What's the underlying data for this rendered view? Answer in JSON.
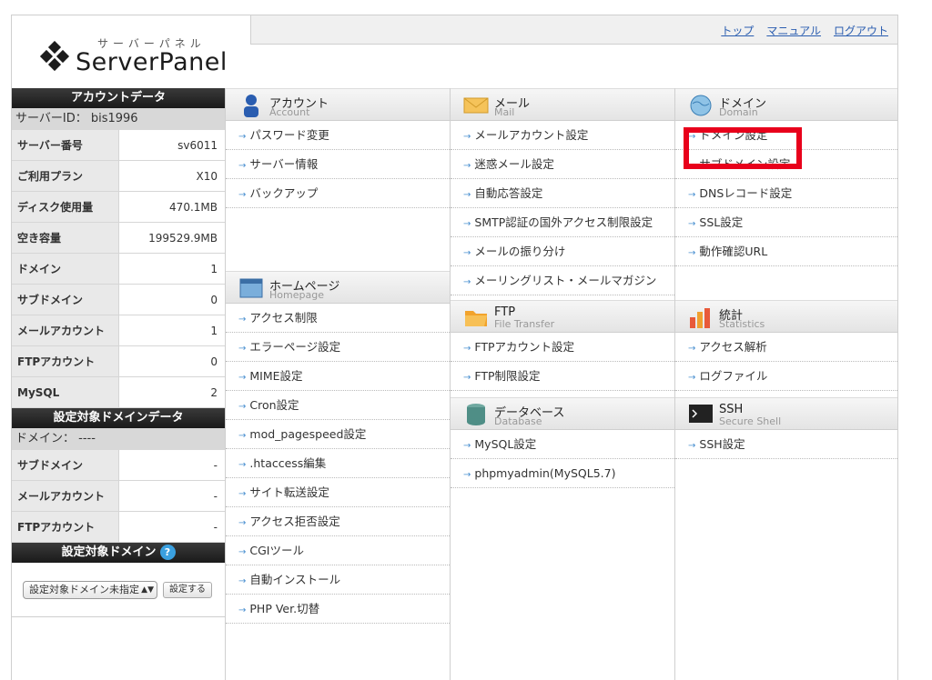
{
  "logo": {
    "kana": "サーバーパネル",
    "name": "ServerPanel"
  },
  "toplinks": [
    "トップ",
    "マニュアル",
    "ログアウト"
  ],
  "account_data": {
    "heading": "アカウントデータ",
    "server_id_label": "サーバーID：",
    "server_id": "bis1996",
    "rows": [
      {
        "label": "サーバー番号",
        "value": "sv6011"
      },
      {
        "label": "ご利用プラン",
        "value": "X10"
      },
      {
        "label": "ディスク使用量",
        "value": "470.1MB"
      },
      {
        "label": "空き容量",
        "value": "199529.9MB"
      },
      {
        "label": "ドメイン",
        "value": "1"
      },
      {
        "label": "サブドメイン",
        "value": "0"
      },
      {
        "label": "メールアカウント",
        "value": "1"
      },
      {
        "label": "FTPアカウント",
        "value": "0"
      },
      {
        "label": "MySQL",
        "value": "2"
      }
    ]
  },
  "domain_data": {
    "heading": "設定対象ドメインデータ",
    "domain_label": "ドメイン：",
    "domain_value": "----",
    "rows": [
      {
        "label": "サブドメイン",
        "value": "-"
      },
      {
        "label": "メールアカウント",
        "value": "-"
      },
      {
        "label": "FTPアカウント",
        "value": "-"
      }
    ]
  },
  "target_domain": {
    "heading": "設定対象ドメイン",
    "help": "?",
    "select_value": "設定対象ドメイン未指定",
    "button": "設定する"
  },
  "sections": {
    "account": {
      "title": "アカウント",
      "sub": "Account",
      "items": [
        "パスワード変更",
        "サーバー情報",
        "バックアップ"
      ]
    },
    "mail": {
      "title": "メール",
      "sub": "Mail",
      "items": [
        "メールアカウント設定",
        "迷惑メール設定",
        "自動応答設定",
        "SMTP認証の国外アクセス制限設定",
        "メールの振り分け",
        "メーリングリスト・メールマガジン"
      ]
    },
    "domain": {
      "title": "ドメイン",
      "sub": "Domain",
      "items": [
        "ドメイン設定",
        "サブドメイン設定",
        "DNSレコード設定",
        "SSL設定",
        "動作確認URL"
      ]
    },
    "homepage": {
      "title": "ホームページ",
      "sub": "Homepage",
      "items": [
        "アクセス制限",
        "エラーページ設定",
        "MIME設定",
        "Cron設定",
        "mod_pagespeed設定",
        ".htaccess編集",
        "サイト転送設定",
        "アクセス拒否設定",
        "CGIツール",
        "自動インストール",
        "PHP Ver.切替"
      ]
    },
    "ftp": {
      "title": "FTP",
      "sub": "File Transfer",
      "items": [
        "FTPアカウント設定",
        "FTP制限設定"
      ]
    },
    "stats": {
      "title": "統計",
      "sub": "Statistics",
      "items": [
        "アクセス解析",
        "ログファイル"
      ]
    },
    "database": {
      "title": "データベース",
      "sub": "Database",
      "items": [
        "MySQL設定",
        "phpmyadmin(MySQL5.7)"
      ]
    },
    "ssh": {
      "title": "SSH",
      "sub": "Secure Shell",
      "items": [
        "SSH設定"
      ]
    }
  },
  "colors": {
    "highlight": "#e8001b",
    "link": "#2a5db0",
    "arrow": "#4a90d0"
  }
}
